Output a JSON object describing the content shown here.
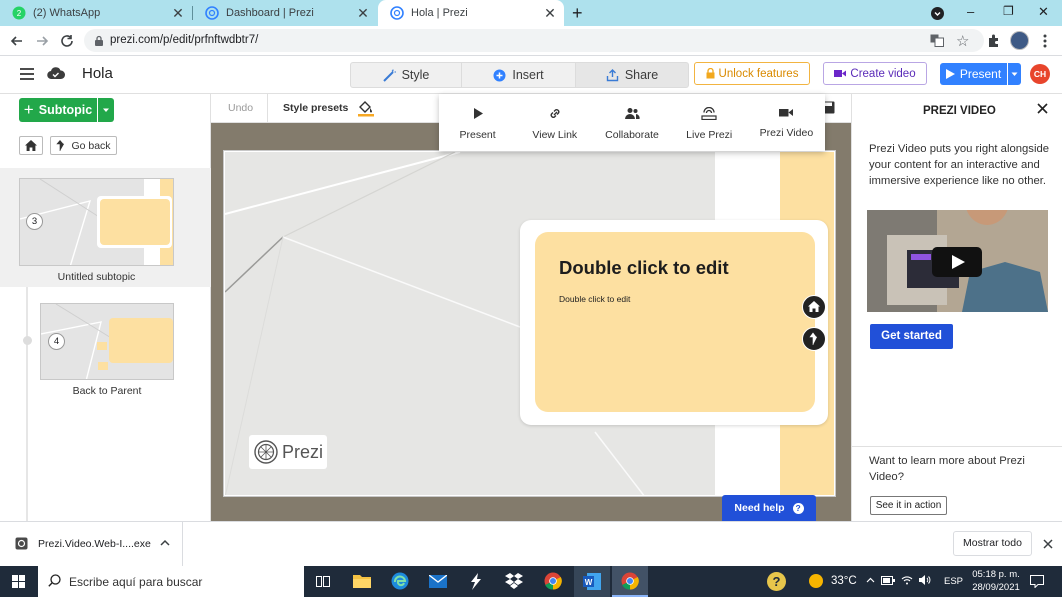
{
  "browser": {
    "tabs": [
      {
        "label": "(2) WhatsApp",
        "badge": "2"
      },
      {
        "label": "Dashboard | Prezi"
      },
      {
        "label": "Hola | Prezi"
      }
    ],
    "new_tab": "+",
    "url": "prezi.com/p/edit/prfnftwdbtr7/",
    "window_controls": {
      "minimize": "–",
      "restore": "❐",
      "close": "✕"
    }
  },
  "header": {
    "title": "Hola",
    "tabs": {
      "style": "Style",
      "insert": "Insert",
      "share": "Share"
    },
    "unlock": "Unlock features",
    "create_video": "Create video",
    "present": "Present",
    "avatar": "CH"
  },
  "left": {
    "subtopic_button": "Subtopic",
    "go_back": "Go back",
    "slides": [
      {
        "num": "3",
        "label": "Untitled subtopic"
      },
      {
        "num": "4",
        "label": "Back to Parent"
      }
    ]
  },
  "editbar": {
    "undo": "Undo",
    "style_presets": "Style presets"
  },
  "share_menu": [
    {
      "label": "Present",
      "icon": "play-icon"
    },
    {
      "label": "View Link",
      "icon": "link-icon"
    },
    {
      "label": "Collaborate",
      "icon": "people-icon"
    },
    {
      "label": "Live Prezi",
      "icon": "broadcast-icon"
    },
    {
      "label": "Prezi Video",
      "icon": "camera-icon"
    }
  ],
  "canvas": {
    "card_title": "Double click to edit",
    "card_body": "Double click to edit",
    "watermark": "Prezi",
    "need_help": "Need help",
    "help_badge": "?"
  },
  "right": {
    "title": "PREZI VIDEO",
    "description": "Prezi Video puts you right alongside your content for an interactive and immersive experience like no other.",
    "get_started": "Get started",
    "learn_more": "Want to learn more about Prezi Video?",
    "see_action": "See it in action"
  },
  "downloads": {
    "file": "Prezi.Video.Web-I....exe",
    "show_all": "Mostrar todo"
  },
  "taskbar": {
    "search": "Escribe aquí para buscar",
    "temp": "33°C",
    "lang": "ESP",
    "time": "05:18 p. m.",
    "date": "28/09/2021"
  },
  "colors": {
    "tabstrip": "#aee1ed",
    "green": "#22a84a",
    "blue": "#3181ff",
    "card_yellow": "#fde0a1",
    "orange": "#f7a823",
    "purple_video": "#6b26c9",
    "avatar_red": "#e8452c",
    "help_blue": "#2150d8"
  }
}
